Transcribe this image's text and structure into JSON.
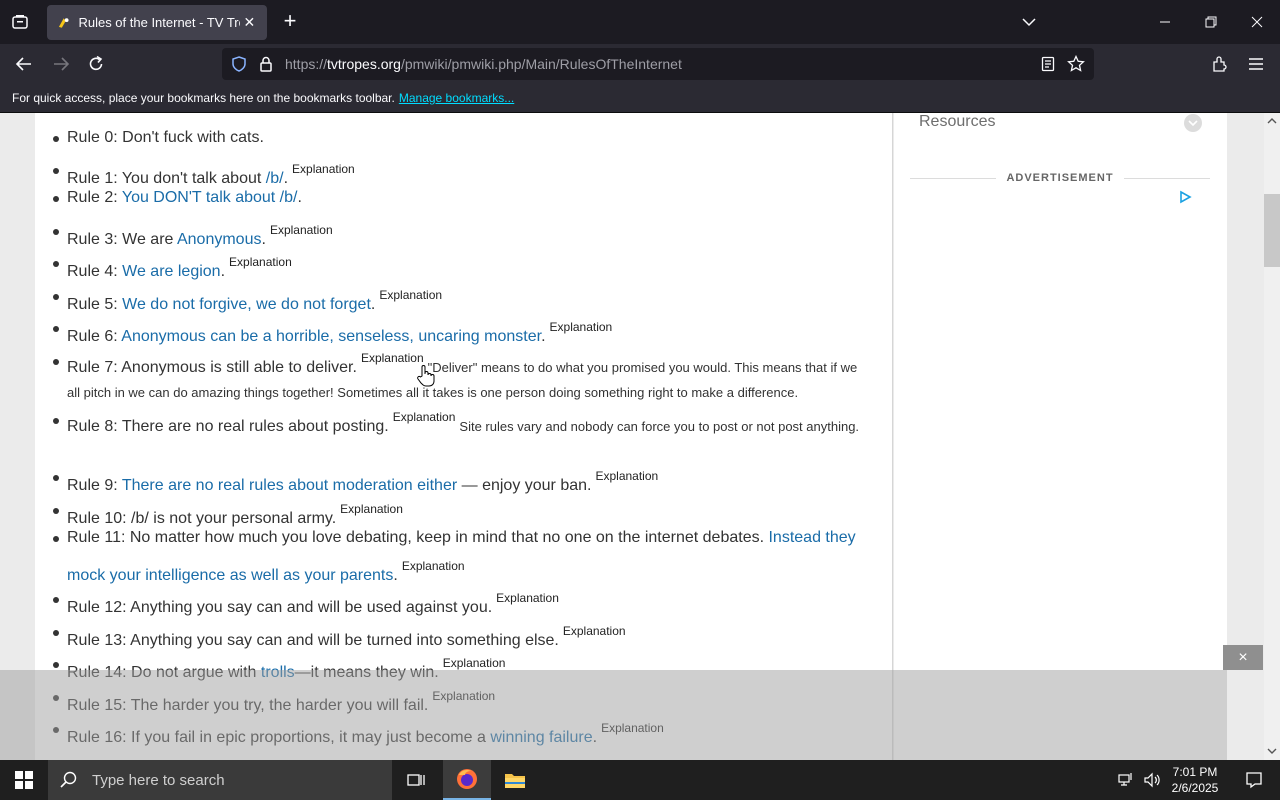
{
  "browser": {
    "tab_title": "Rules of the Internet - TV Tropes",
    "url_host": "tvtropes.org",
    "url_path": "/pmwiki/pmwiki.php/Main/RulesOfTheInternet",
    "url_scheme": "https://",
    "bookmarks_message": "For quick access, place your bookmarks here on the bookmarks toolbar.",
    "bookmarks_link": "Manage bookmarks..."
  },
  "sidebar": {
    "resources_label": "Resources",
    "ad_label": "ADVERTISEMENT"
  },
  "rules": [
    {
      "prefix": "Rule 0: Don't fuck with cats.",
      "link": "",
      "suffix": "",
      "sup": "",
      "note": ""
    },
    {
      "prefix": "Rule 1: You don't talk about ",
      "link": "/b/",
      "suffix": ".",
      "sup": "Explanation",
      "note": ""
    },
    {
      "prefix": "Rule 2: ",
      "link": "You DON'T talk about /b/",
      "suffix": ".",
      "sup": "",
      "note": ""
    },
    {
      "prefix": "Rule 3: We are ",
      "link": "Anonymous",
      "suffix": ".",
      "sup": "Explanation",
      "note": ""
    },
    {
      "prefix": "Rule 4: ",
      "link": "We are legion",
      "suffix": ".",
      "sup": "Explanation",
      "note": ""
    },
    {
      "prefix": "Rule 5: ",
      "link": "We do not forgive, we do not forget",
      "suffix": ".",
      "sup": "Explanation",
      "note": ""
    },
    {
      "prefix": "Rule 6: ",
      "link": "Anonymous can be a horrible, senseless, uncaring monster",
      "suffix": ".",
      "sup": "Explanation",
      "note": ""
    },
    {
      "prefix": "Rule 7: Anonymous is still able to deliver.",
      "link": "",
      "suffix": "",
      "sup": "Explanation",
      "note": "\"Deliver\" means to do what you promised you would. This means that if we all pitch in we can do amazing things together! Sometimes all it takes is one person doing something right to make a difference."
    },
    {
      "prefix": "Rule 8: There are no real rules about posting.",
      "link": "",
      "suffix": "",
      "sup": "Explanation",
      "note": "Site rules vary and nobody can force you to post or not post anything."
    },
    {
      "prefix": "Rule 9: ",
      "link": "There are no real rules about moderation either",
      "suffix": " — enjoy your ban.",
      "sup": "Explanation",
      "note": ""
    },
    {
      "prefix": "Rule 10: /b/ is not your personal army.",
      "link": "",
      "suffix": "",
      "sup": "Explanation",
      "note": ""
    },
    {
      "prefix": "Rule 11: No matter how much you love debating, keep in mind that no one on the internet debates. ",
      "link": "Instead they mock your intelligence as well as your parents",
      "suffix": ".",
      "sup": "Explanation",
      "note": ""
    },
    {
      "prefix": "Rule 12: Anything you say can and will be used against you.",
      "link": "",
      "suffix": "",
      "sup": "Explanation",
      "note": ""
    },
    {
      "prefix": "Rule 13: Anything you say can and will be turned into something else.",
      "link": "",
      "suffix": "",
      "sup": "Explanation",
      "note": ""
    },
    {
      "prefix": "Rule 14: Do not argue with ",
      "link": "trolls",
      "suffix": "—it means they win.",
      "sup": "Explanation",
      "note": ""
    },
    {
      "prefix": "Rule 15: The harder you try, the harder you will fail.",
      "link": "",
      "suffix": "",
      "sup": "Explanation",
      "note": ""
    },
    {
      "prefix": "Rule 16: If you fail in epic proportions, it may just become a ",
      "link": "winning failure",
      "suffix": ".",
      "sup": "Explanation",
      "note": ""
    }
  ],
  "overlay_close": "×",
  "taskbar": {
    "search_placeholder": "Type here to search",
    "time": "7:01 PM",
    "date": "2/6/2025"
  },
  "colors": {
    "link": "#1a6ca8",
    "url_accent": "#00ddff"
  }
}
